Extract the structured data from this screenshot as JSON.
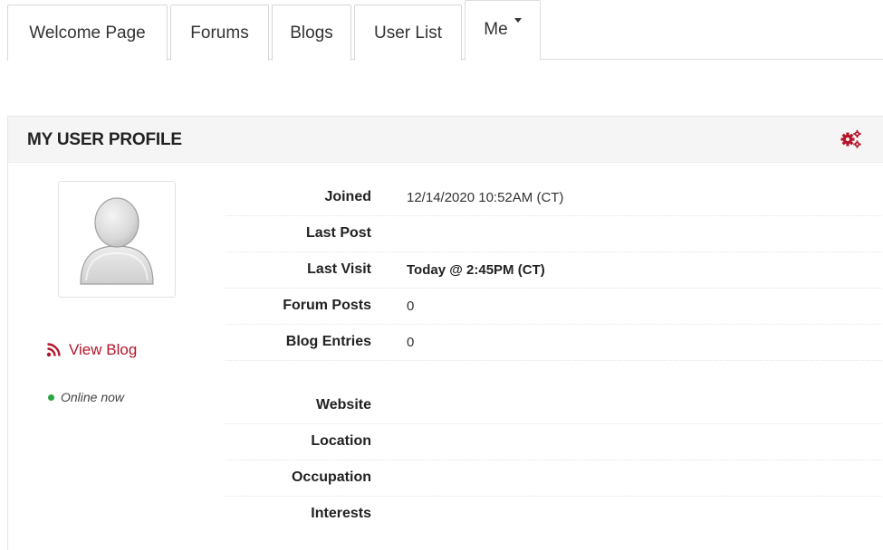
{
  "tabs": [
    {
      "label": "Welcome Page",
      "active": false
    },
    {
      "label": "Forums",
      "active": false
    },
    {
      "label": "Blogs",
      "active": false
    },
    {
      "label": "User List",
      "active": false
    },
    {
      "label": "Me",
      "active": true
    }
  ],
  "panel": {
    "title": "MY USER PROFILE",
    "settings_icon": "gears-icon",
    "accent_color": "#b5152b"
  },
  "sidebar": {
    "avatar_icon": "default-user-avatar",
    "view_blog_label": "View Blog",
    "rss_icon": "rss-icon",
    "status_text": "Online now",
    "status_color": "#2aa640"
  },
  "profile": {
    "joined": {
      "label": "Joined",
      "value": "12/14/2020 10:52AM (CT)"
    },
    "last_post": {
      "label": "Last Post",
      "value": ""
    },
    "last_visit": {
      "label": "Last Visit",
      "value": "Today @ 2:45PM (CT)"
    },
    "forum_posts": {
      "label": "Forum Posts",
      "value": "0"
    },
    "blog_entries": {
      "label": "Blog Entries",
      "value": "0"
    },
    "website": {
      "label": "Website",
      "value": ""
    },
    "location": {
      "label": "Location",
      "value": ""
    },
    "occupation": {
      "label": "Occupation",
      "value": ""
    },
    "interests": {
      "label": "Interests",
      "value": ""
    }
  }
}
